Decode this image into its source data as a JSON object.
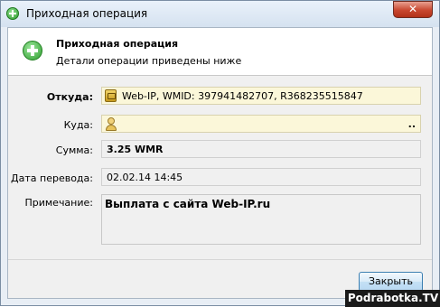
{
  "window": {
    "title": "Приходная операция"
  },
  "header": {
    "title": "Приходная операция",
    "subtitle": "Детали операции приведены ниже"
  },
  "fields": {
    "from": {
      "label": "Откуда:",
      "value": "Web-IP, WMID: 397941482707, R368235515847",
      "icon": "purse-icon"
    },
    "to": {
      "label": "Куда:",
      "value": "",
      "icon": "person-icon",
      "more": ".."
    },
    "amount": {
      "label": "Сумма:",
      "value": "3.25 WMR"
    },
    "date": {
      "label": "Дата перевода:",
      "value": "02.02.14 14:45"
    },
    "note": {
      "label": "Примечание:",
      "value": "Выплата с сайта Web-IP.ru"
    }
  },
  "buttons": {
    "close": "Закрыть"
  },
  "watermark": "Podrabotka.TV",
  "colors": {
    "field_highlight": "#fbf7d9",
    "close_button_border": "#3c7fb1",
    "titlebar_close": "#c8472f"
  }
}
